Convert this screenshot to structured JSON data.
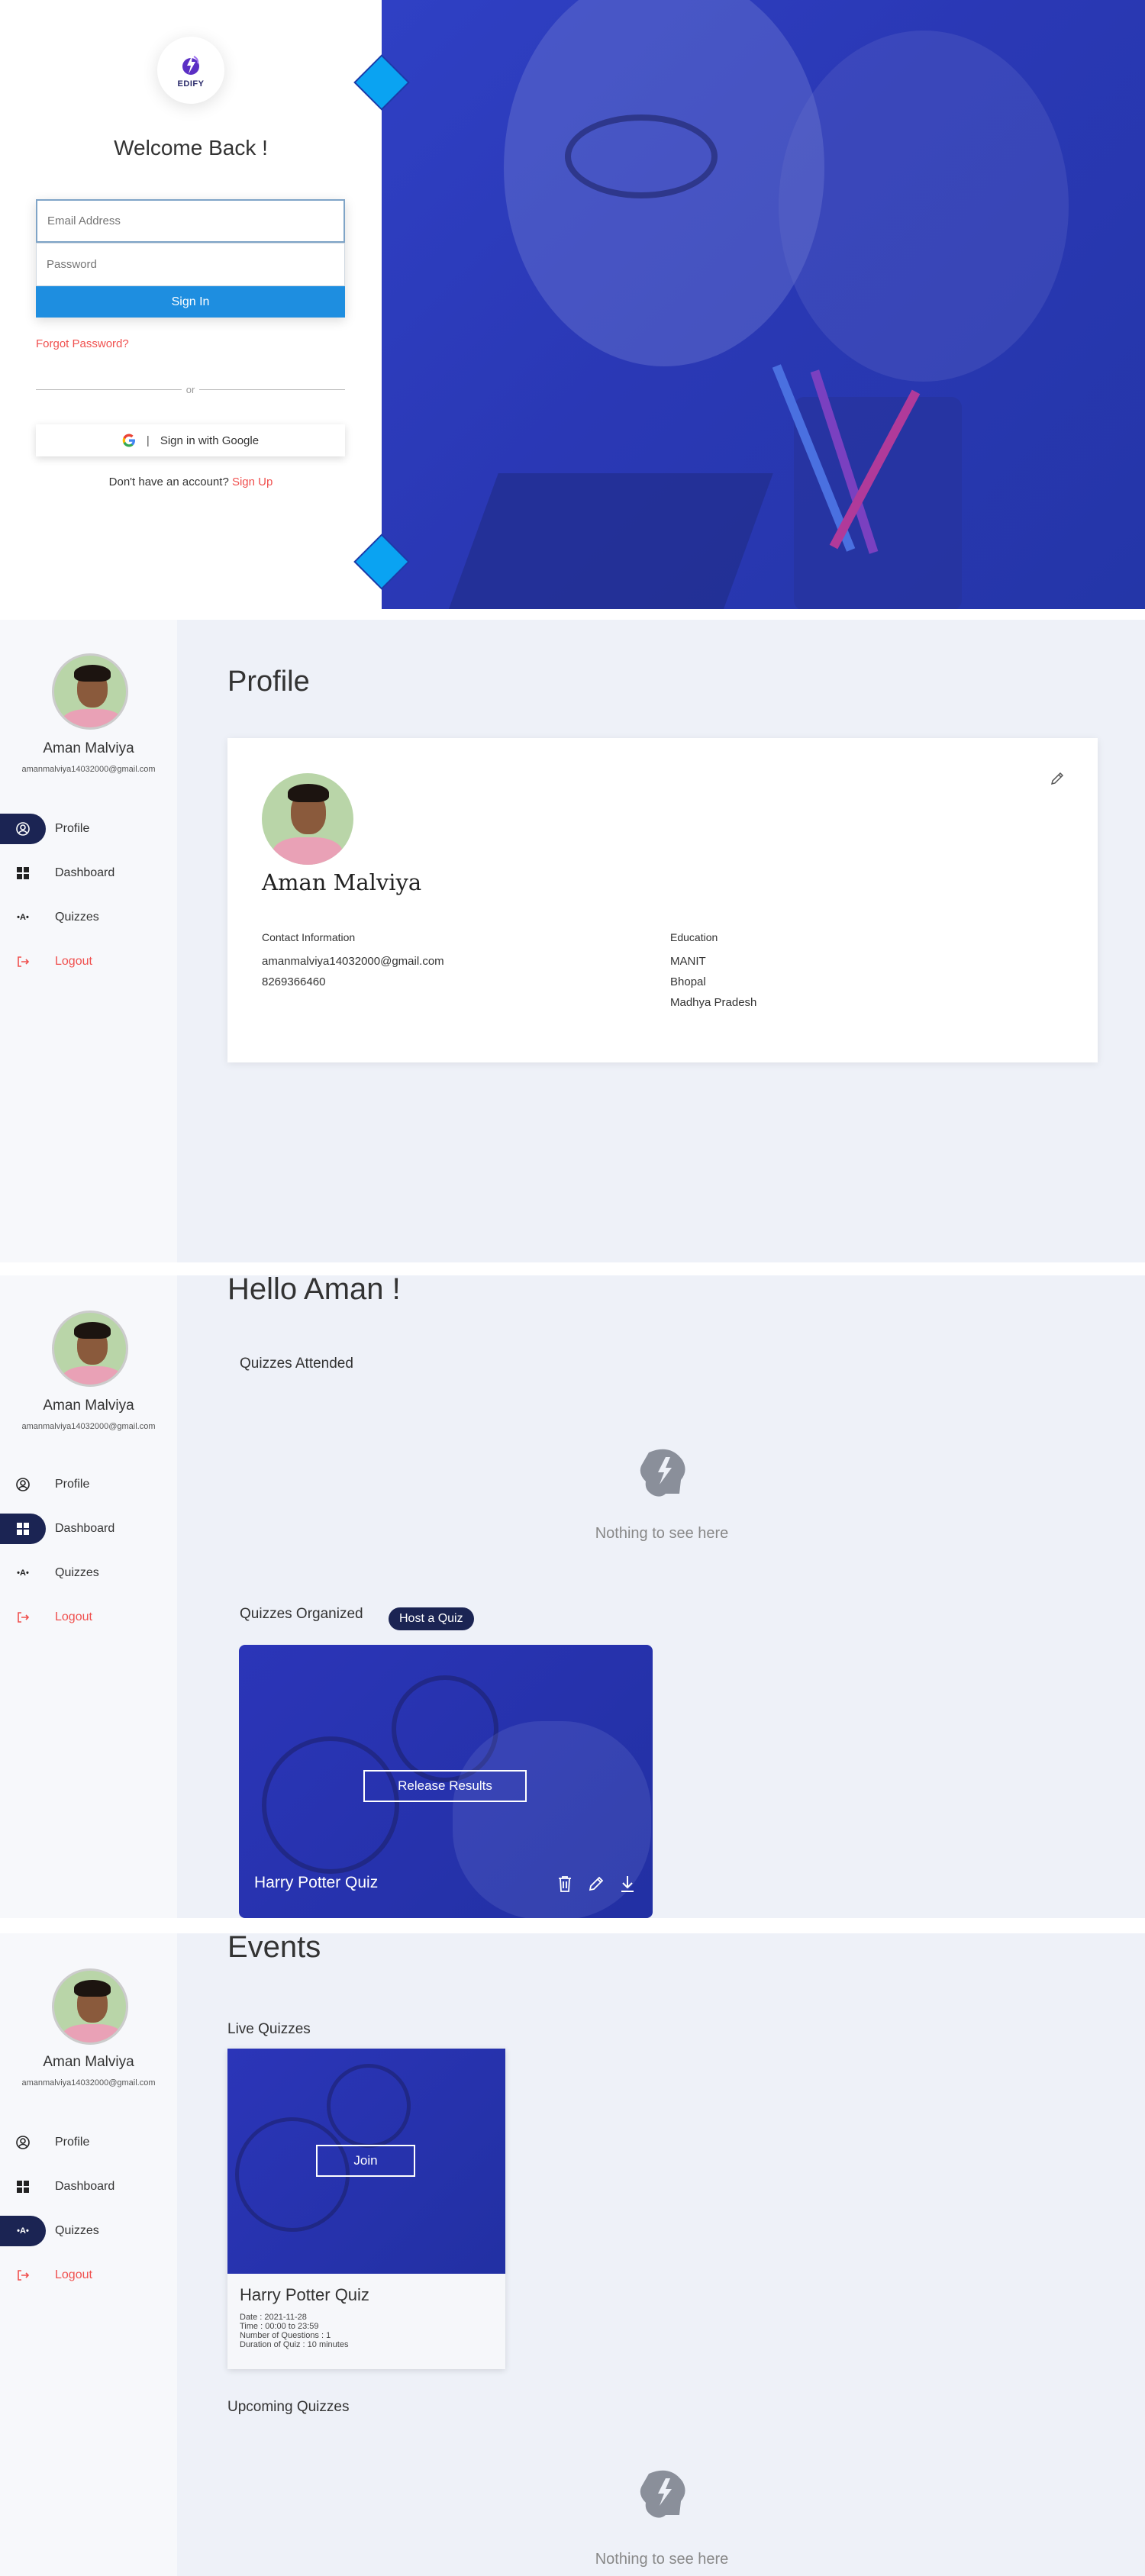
{
  "login": {
    "logo_text": "EDIFY",
    "welcome": "Welcome Back !",
    "email_placeholder": "Email Address",
    "password_placeholder": "Password",
    "signin_label": "Sign In",
    "forgot": "Forgot Password?",
    "or": "or",
    "google_label": "Sign in with Google",
    "no_account": "Don't have an account?",
    "signup": "Sign Up"
  },
  "user": {
    "name": "Aman Malviya",
    "email": "amanmalviya14032000@gmail.com"
  },
  "nav": {
    "profile": "Profile",
    "dashboard": "Dashboard",
    "quizzes": "Quizzes",
    "logout": "Logout"
  },
  "profile": {
    "title": "Profile",
    "name": "Aman Malviya",
    "contact_heading": "Contact Information",
    "contact_email": "amanmalviya14032000@gmail.com",
    "contact_phone": "8269366460",
    "education_heading": "Education",
    "edu_line1": "MANIT",
    "edu_line2": "Bhopal",
    "edu_line3": "Madhya Pradesh"
  },
  "dashboard": {
    "greeting": "Hello Aman !",
    "attended_heading": "Quizzes Attended",
    "empty_text": "Nothing to see here",
    "organized_heading": "Quizzes Organized",
    "host_button": "Host a Quiz",
    "quiz_title": "Harry Potter Quiz",
    "release_button": "Release Results"
  },
  "events": {
    "title": "Events",
    "live_heading": "Live Quizzes",
    "join_button": "Join",
    "quiz_title": "Harry Potter Quiz",
    "date": "Date : 2021-11-28",
    "time": "Time : 00:00 to 23:59",
    "questions": "Number of Questions : 1",
    "duration": "Duration of Quiz : 10 minutes",
    "upcoming_heading": "Upcoming Quizzes",
    "empty_text": "Nothing to see here"
  },
  "colors": {
    "accent_blue": "#1e8ee0",
    "navy": "#1b2453",
    "link_red": "#f0504e",
    "hero_blue": "#2f40c4",
    "diamond": "#0aa3f2"
  },
  "icons": [
    "edify-logo-icon",
    "google-icon",
    "pencil-icon",
    "user-circle-icon",
    "grid-icon",
    "quiz-icon",
    "logout-icon",
    "trash-icon",
    "download-icon",
    "empty-state-icon"
  ]
}
